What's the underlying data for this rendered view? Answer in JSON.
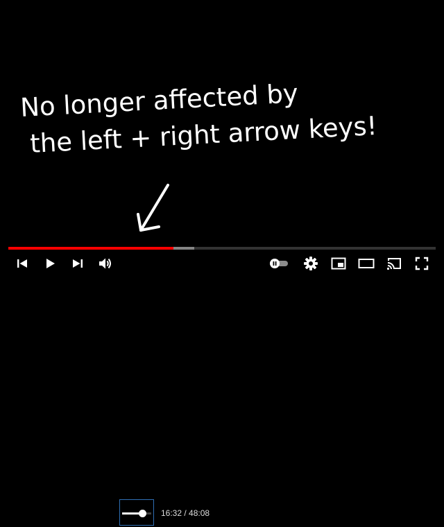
{
  "video": {
    "annotation_line1": "No longer affected by",
    "annotation_line2": "the left + right arrow keys!"
  },
  "player": {
    "progress_played_fraction": 0.386,
    "progress_buffered_fraction": 0.435,
    "volume_fraction": 0.68,
    "current_time": "16:32",
    "time_separator": " / ",
    "duration": "48:08",
    "autoplay_on": false
  },
  "colors": {
    "progress": "#ff0000",
    "volume_highlight_border": "#2f6fb5"
  },
  "icons": {
    "previous": "skip-previous-icon",
    "play": "play-icon",
    "next": "skip-next-icon",
    "volume": "volume-icon",
    "autoplay": "autoplay-toggle-icon",
    "settings": "gear-icon",
    "miniplayer": "miniplayer-icon",
    "theater": "theater-mode-icon",
    "cast": "cast-icon",
    "fullscreen": "fullscreen-icon"
  }
}
